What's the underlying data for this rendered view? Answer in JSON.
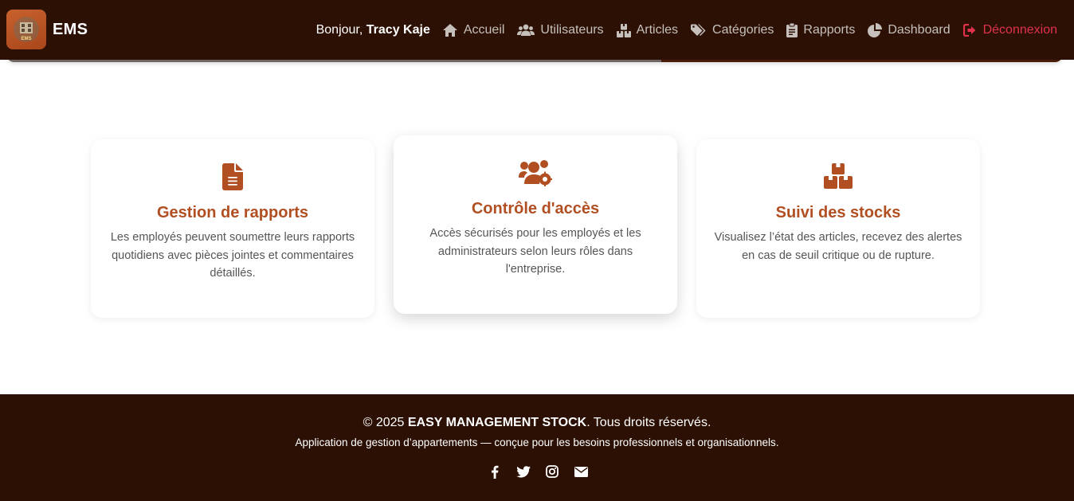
{
  "brand": {
    "name": "EMS",
    "logo_text": "EMS"
  },
  "nav": {
    "greeting_prefix": "Bonjour,",
    "user_name": "Tracy Kaje",
    "links": [
      {
        "label": "Accueil",
        "icon": "home-icon"
      },
      {
        "label": "Utilisateurs",
        "icon": "users-icon"
      },
      {
        "label": "Articles",
        "icon": "boxes-icon"
      },
      {
        "label": "Catégories",
        "icon": "tags-icon"
      },
      {
        "label": "Rapports",
        "icon": "clipboard-icon"
      },
      {
        "label": "Dashboard",
        "icon": "pie-chart-icon"
      },
      {
        "label": "Déconnexion",
        "icon": "sign-out-icon"
      }
    ]
  },
  "progress": {
    "percent": 62
  },
  "features": [
    {
      "icon": "file-icon",
      "title": "Gestion de rapports",
      "text": "Les employés peuvent soumettre leurs rapports quotidiens avec pièces jointes et commentaires détaillés."
    },
    {
      "icon": "users-cog-icon",
      "title": "Contrôle d'accès",
      "text": "Accès sécurisés pour les employés et les administrateurs selon leurs rôles dans l'entreprise."
    },
    {
      "icon": "boxes-icon",
      "title": "Suivi des stocks",
      "text": "Visualisez l’état des articles, recevez des alertes en cas de seuil critique ou de rupture."
    }
  ],
  "footer": {
    "copyright_prefix": "© 2025",
    "company": "EASY MANAGEMENT STOCK",
    "rights": ". Tous droits réservés.",
    "tagline": "Application de gestion d’appartements — conçue pour les besoins professionnels et organisationnels.",
    "socials": [
      "facebook-icon",
      "twitter-icon",
      "instagram-icon",
      "envelope-icon"
    ]
  },
  "colors": {
    "nav_bg": "#2c1004",
    "accent": "#b14f22",
    "logout": "#e0324a",
    "nav_link": "#c6c0bc"
  }
}
